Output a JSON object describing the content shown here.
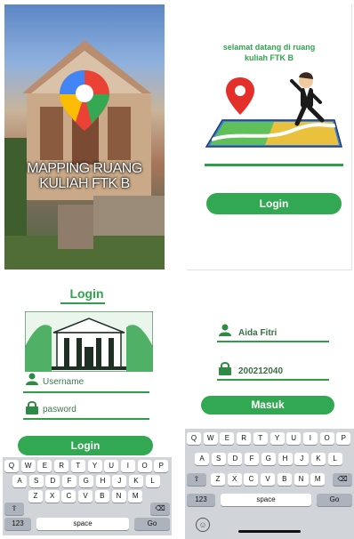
{
  "splash": {
    "title_line1": "MAPPING RUANG",
    "title_line2": "KULIAH FTK B"
  },
  "welcome": {
    "heading_line1": "selamat datang di ruang",
    "heading_line2": "kuliah FTK B",
    "login_button": "Login"
  },
  "login": {
    "title": "Login",
    "username_placeholder": "Username",
    "password_placeholder": "pasword",
    "login_button": "Login"
  },
  "filled": {
    "username_value": "Aida Fitri",
    "password_value": "200212040",
    "submit_button": "Masuk"
  },
  "keyboard": {
    "row1": [
      "Q",
      "W",
      "E",
      "R",
      "T",
      "Y",
      "U",
      "I",
      "O",
      "P"
    ],
    "row2": [
      "A",
      "S",
      "D",
      "F",
      "G",
      "H",
      "J",
      "K",
      "L"
    ],
    "row3": [
      "Z",
      "X",
      "C",
      "V",
      "B",
      "N",
      "M"
    ],
    "numbers_key": "123",
    "space_key": "space",
    "go_key": "Go"
  },
  "colors": {
    "accent": "#33a852",
    "underline": "#2f9e4a"
  }
}
